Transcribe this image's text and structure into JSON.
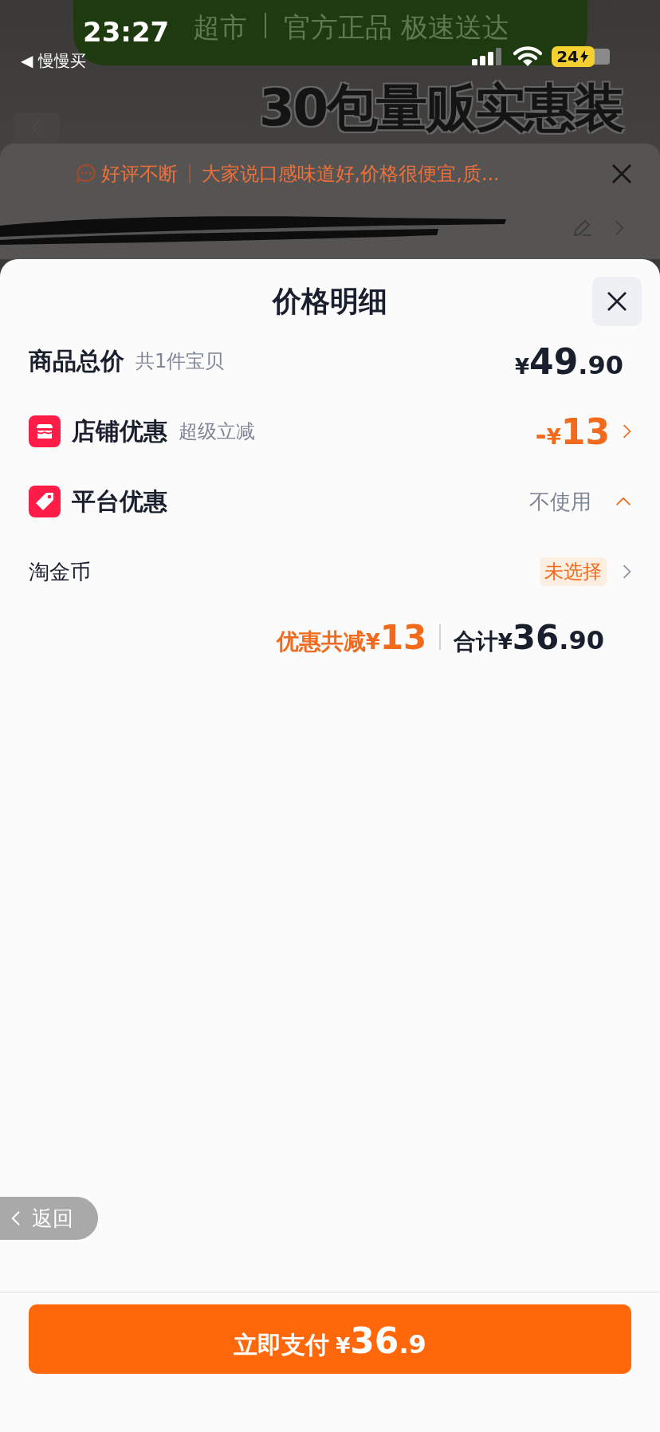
{
  "status_bar": {
    "time": "23:27",
    "back_app": "◀ 慢慢买",
    "battery": "24"
  },
  "background_page": {
    "banner_brand": "超市",
    "banner_slogan": "官方正品 极速送达",
    "headline": "30包量贩实惠装"
  },
  "notice": {
    "tag": "好评不断",
    "text": "大家说口感味道好,价格很便宜,质..."
  },
  "sheet": {
    "title": "价格明细",
    "rows": [
      {
        "kind": "total",
        "label": "商品总价",
        "sub": "共1件宝贝",
        "price": {
          "currency": "¥",
          "int": "49",
          "dec": ".90"
        }
      },
      {
        "kind": "shop",
        "label": "店铺优惠",
        "sub": "超级立减",
        "price": {
          "sign": "-",
          "currency": "¥",
          "int": "13"
        }
      },
      {
        "kind": "platform",
        "label": "平台优惠",
        "value": "不使用",
        "expanded": true
      },
      {
        "kind": "coins",
        "label": "淘金币",
        "badge": "未选择"
      }
    ],
    "summary": {
      "discount_label": "优惠共减",
      "discount_currency": "¥",
      "discount_amount": "13",
      "total_label": "合计",
      "total_currency": "¥",
      "total_int": "36",
      "total_dec": ".90"
    }
  },
  "back_button": "返回",
  "pay_button": {
    "label": "立即支付",
    "currency": "¥",
    "int": "36",
    "dec": ".9"
  }
}
